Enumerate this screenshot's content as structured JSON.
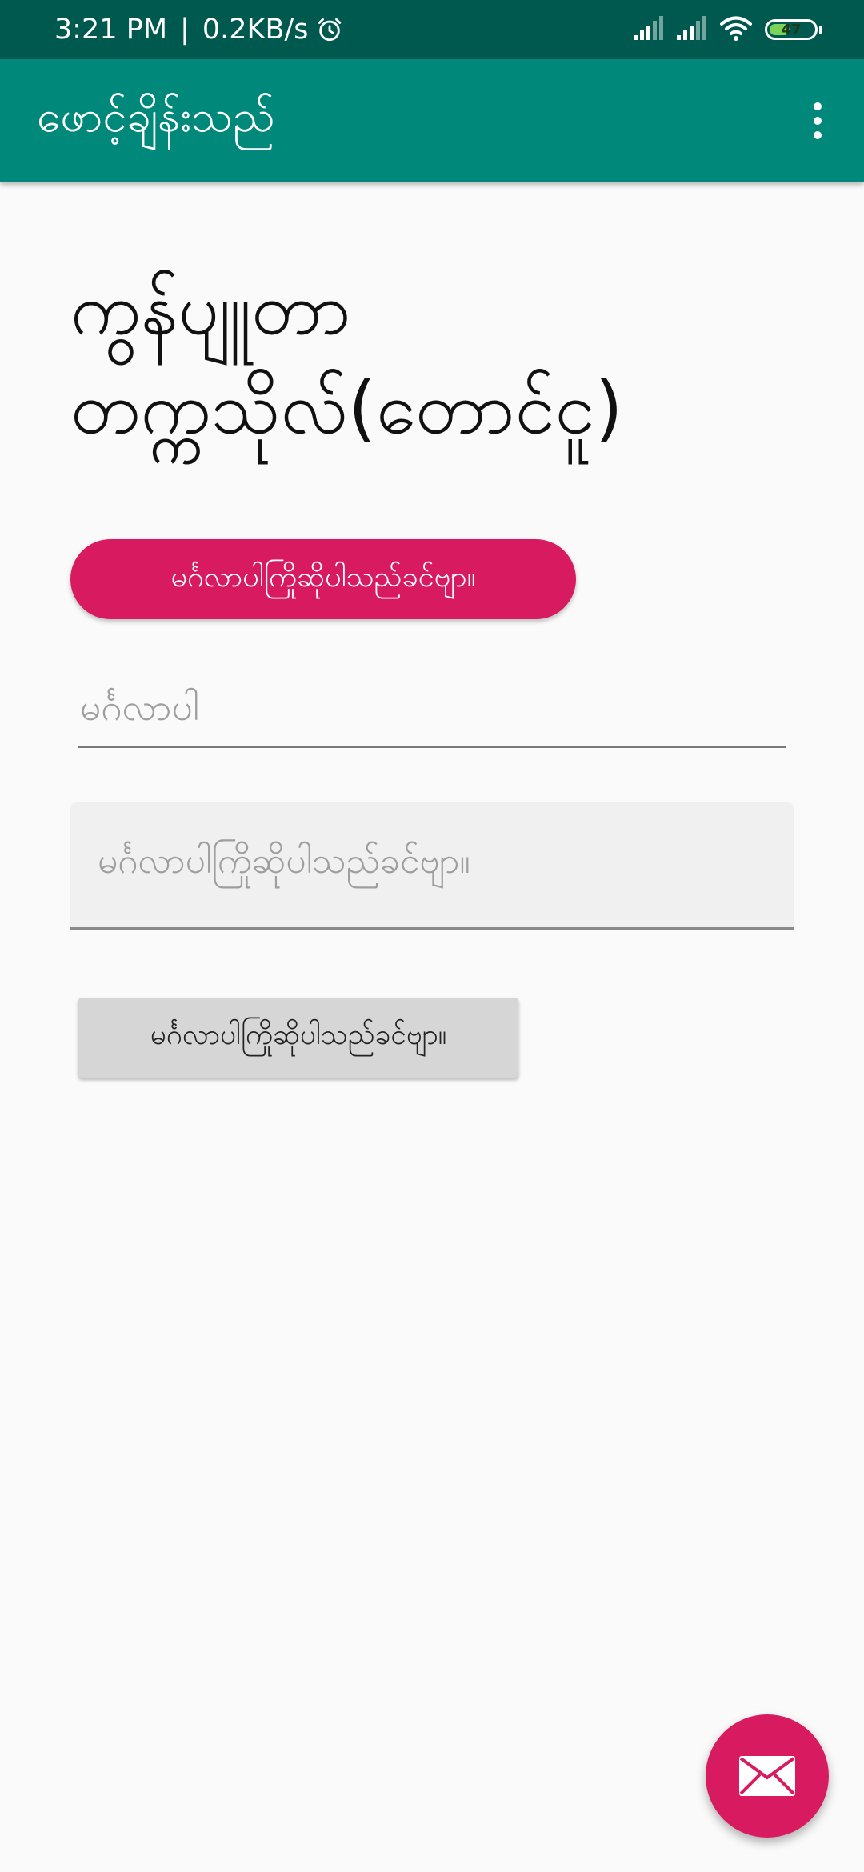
{
  "status_bar": {
    "time": "3:21 PM",
    "separator": "|",
    "net_speed": "0.2KB/s",
    "battery": "47",
    "battery_level_percent": 47,
    "icons": [
      "alarm-icon",
      "signal-icon",
      "signal-icon",
      "wifi-icon",
      "battery-icon"
    ]
  },
  "app_bar": {
    "title": "ဖောင့်ချိန်းသည်",
    "menu_icon": "more-vert-icon"
  },
  "main": {
    "headline": "ကွန်ပျူတာတက္ကသိုလ်(တောင်ငူ)",
    "pill_button_label": "မင်္ဂလာပါကြိုဆိုပါသည်ခင်ဗျာ။",
    "text_input_placeholder": "မင်္ဂလာပါ",
    "filled_input_placeholder": "မင်္ဂလာပါကြိုဆိုပါသည်ခင်ဗျာ။",
    "flat_button_label": "မင်္ဂလာပါကြိုဆိုပါသည်ခင်ဗျာ။"
  },
  "fab": {
    "icon": "mail-icon"
  },
  "colors": {
    "status_bar": "#00594f",
    "primary": "#00897b",
    "accent": "#d81b60",
    "background": "#fafafa"
  }
}
